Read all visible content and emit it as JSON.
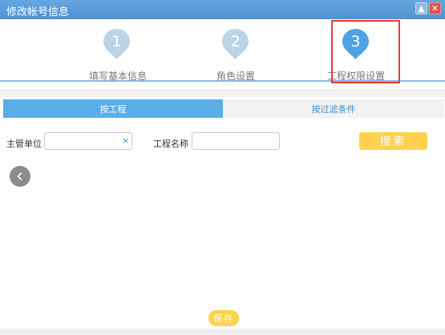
{
  "window": {
    "title": "修改帐号信息",
    "minimize_glyph": "▲",
    "close_glyph": "✕"
  },
  "steps": [
    {
      "number": "1",
      "label": "填写基本信息",
      "state": "done"
    },
    {
      "number": "2",
      "label": "角色设置",
      "state": "done"
    },
    {
      "number": "3",
      "label": "工程权限设置",
      "state": "current"
    }
  ],
  "tabs": [
    {
      "label": "按工程",
      "active": true
    },
    {
      "label": "按过滤条件",
      "active": false
    }
  ],
  "form": {
    "unit_label": "主管单位",
    "unit_value": "",
    "unit_clear_glyph": "×",
    "project_label": "工程名称",
    "project_value": "",
    "search_label": "搜索"
  },
  "footer": {
    "save_label": "保存"
  },
  "colors": {
    "titlebar": "#5b9bd5",
    "step_done": "#bcd4e8",
    "step_current": "#4ea3e6",
    "tab_active": "#5aaee8",
    "button_yellow": "#ffd24d",
    "highlight_red": "#e53935"
  }
}
